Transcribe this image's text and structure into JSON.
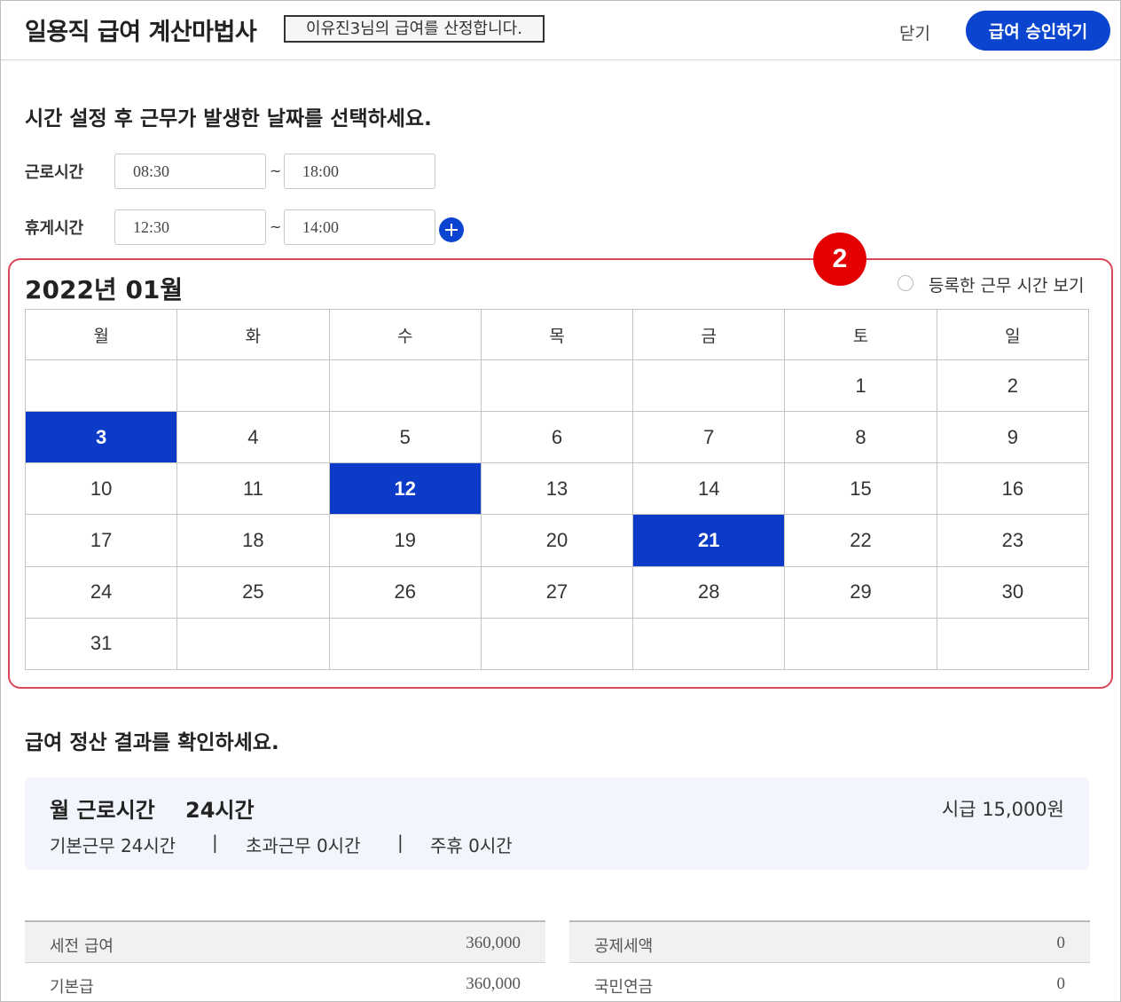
{
  "header": {
    "app_title": "일용직 급여 계산마법사",
    "subtitle": "이유진3님의 급여를 산정합니다.",
    "close_label": "닫기",
    "approve_label": "급여 승인하기"
  },
  "time_settings": {
    "instruction": "시간 설정 후 근무가 발생한 날짜를 선택하세요.",
    "work": {
      "label": "근로시간",
      "start": "08:30",
      "end": "18:00"
    },
    "break": {
      "label": "휴게시간",
      "start": "12:30",
      "end": "14:00"
    },
    "separator": "~"
  },
  "calendar": {
    "step_badge": "2",
    "month_title": "2022년 01월",
    "toggle_label": "등록한 근무 시간 보기",
    "weekdays": [
      "월",
      "화",
      "수",
      "목",
      "금",
      "토",
      "일"
    ],
    "weeks": [
      [
        "",
        "",
        "",
        "",
        "",
        "1",
        "2"
      ],
      [
        "3",
        "4",
        "5",
        "6",
        "7",
        "8",
        "9"
      ],
      [
        "10",
        "11",
        "12",
        "13",
        "14",
        "15",
        "16"
      ],
      [
        "17",
        "18",
        "19",
        "20",
        "21",
        "22",
        "23"
      ],
      [
        "24",
        "25",
        "26",
        "27",
        "28",
        "29",
        "30"
      ],
      [
        "31",
        "",
        "",
        "",
        "",
        "",
        ""
      ]
    ],
    "selected_days": [
      "3",
      "12",
      "21"
    ],
    "selected_color": "#0b3bc7"
  },
  "result": {
    "title": "급여 정산 결과를 확인하세요.",
    "summary": {
      "monthly_label": "월 근로시간",
      "monthly_hours": "24시간",
      "hourly_wage": "시급 15,000원",
      "basic": "기본근무 24시간",
      "overtime": "초과근무 0시간",
      "weekly_rest": "주휴 0시간",
      "separator": "|"
    },
    "left_table": [
      {
        "label": "세전 급여",
        "value": "360,000"
      },
      {
        "label": "기본급",
        "value": "360,000"
      }
    ],
    "right_table": [
      {
        "label": "공제세액",
        "value": "0"
      },
      {
        "label": "국민연금",
        "value": "0"
      }
    ]
  },
  "colors": {
    "accent": "#0b45cf",
    "highlight_border": "#d8475c",
    "badge": "#e40000"
  }
}
